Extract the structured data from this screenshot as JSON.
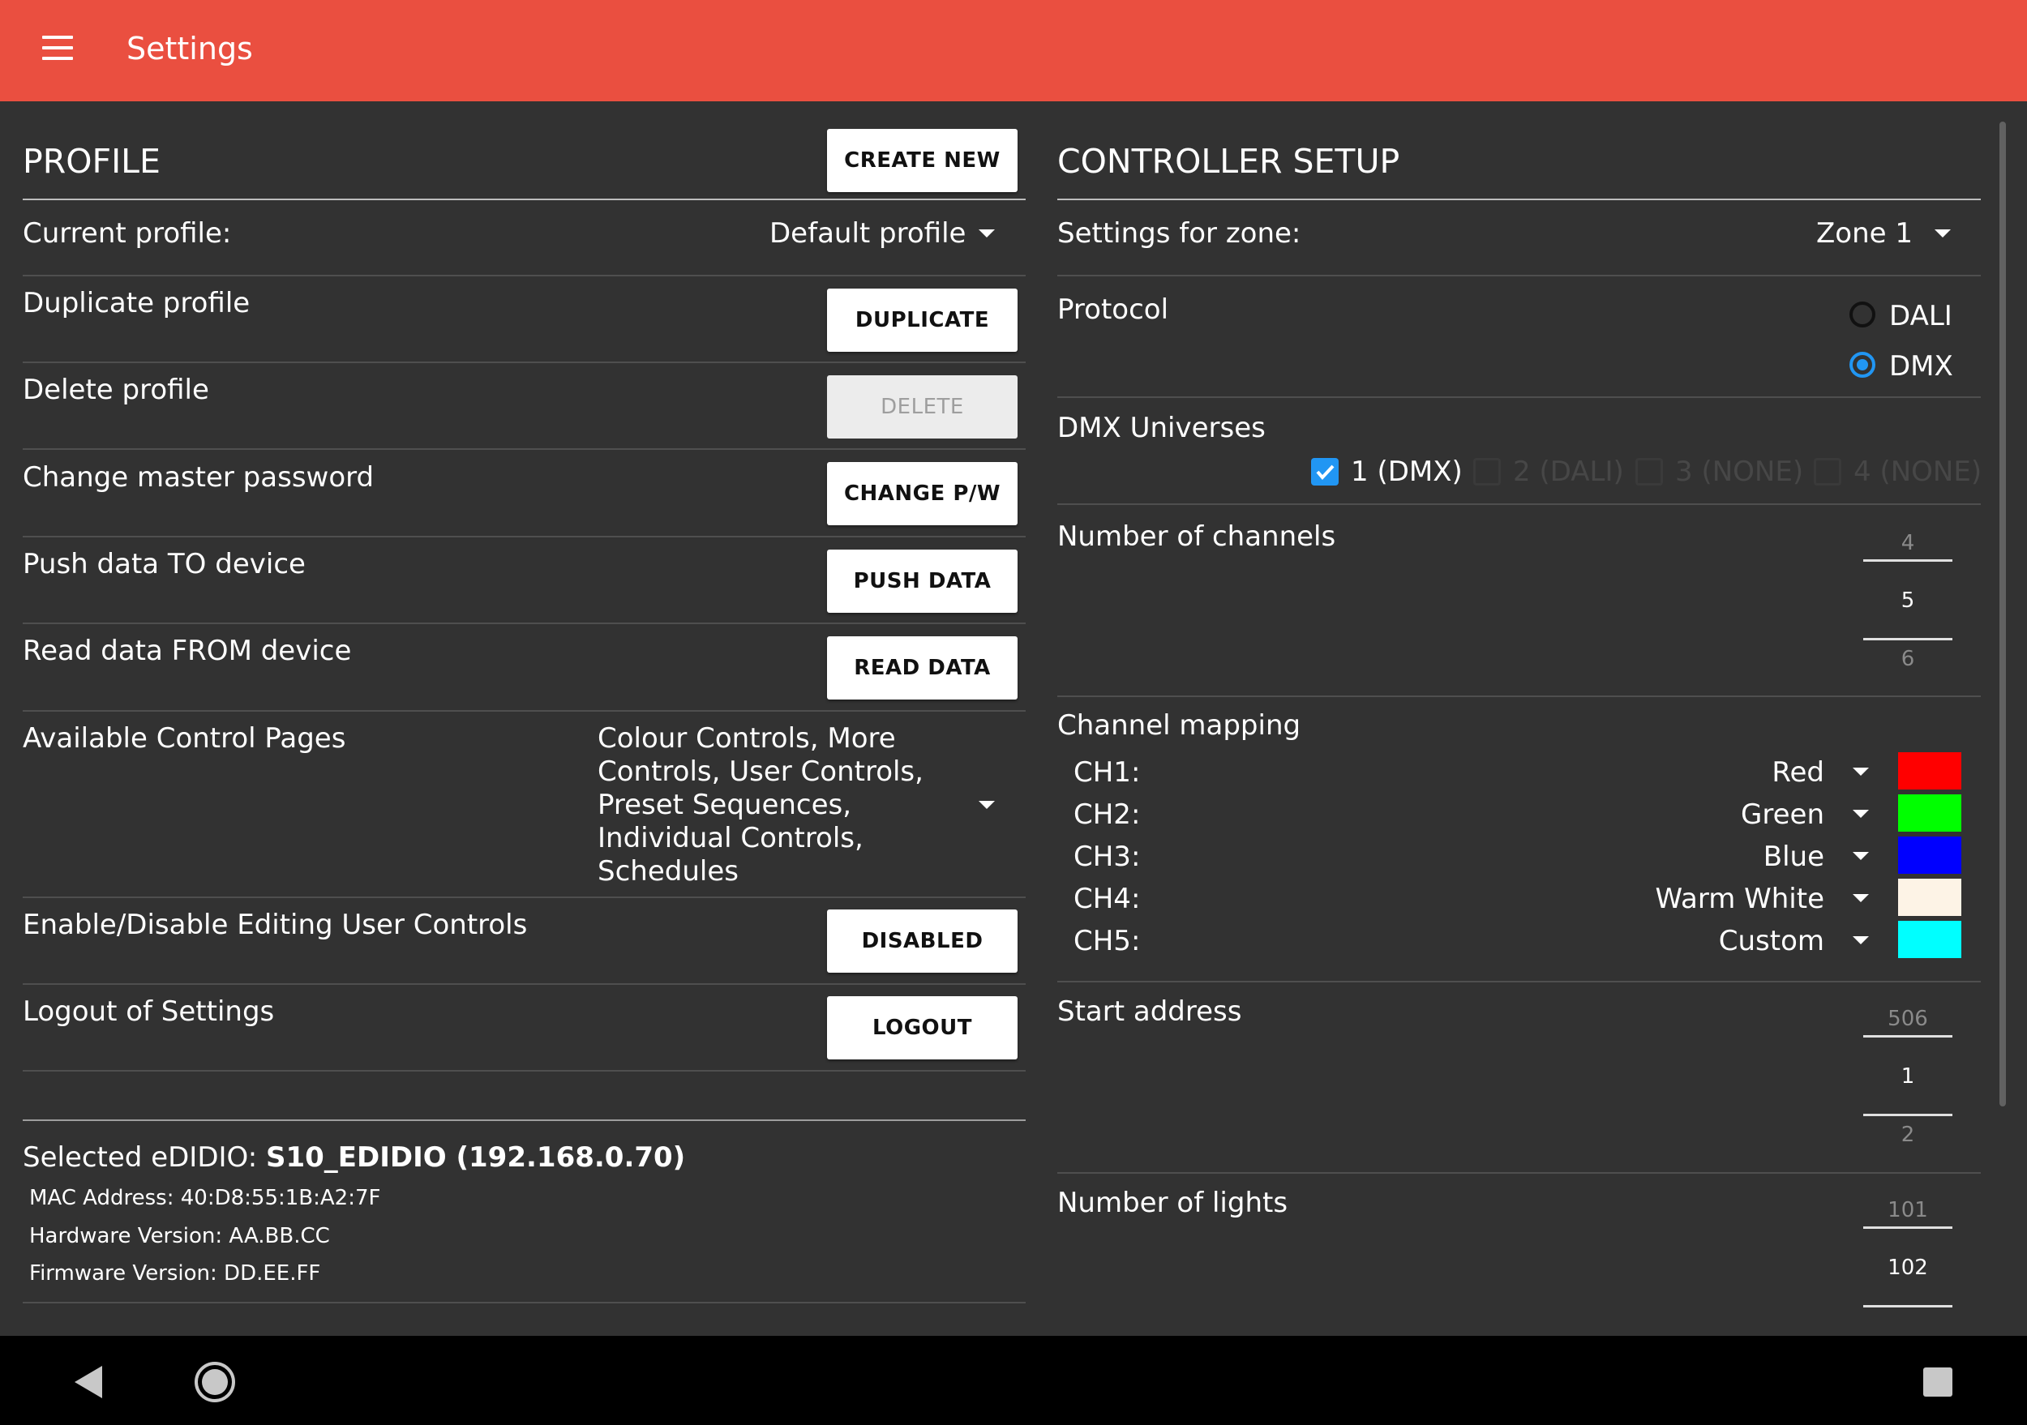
{
  "app_bar": {
    "title": "Settings",
    "menu_icon": "hamburger-menu-icon",
    "color": "#ea4f40"
  },
  "profile": {
    "title": "PROFILE",
    "create_new_label": "CREATE NEW",
    "current_profile_label": "Current profile:",
    "current_profile_value": "Default profile",
    "duplicate_label": "Duplicate profile",
    "duplicate_button": "DUPLICATE",
    "delete_label": "Delete profile",
    "delete_button": "DELETE",
    "change_pw_label": "Change master password",
    "change_pw_button": "CHANGE P/W",
    "push_label": "Push data TO device",
    "push_button": "PUSH DATA",
    "read_label": "Read data FROM device",
    "read_button": "READ DATA",
    "control_pages_label": "Available Control Pages",
    "control_pages_lines": [
      "Colour Controls, More",
      "Controls, User Controls,",
      "Preset Sequences,",
      "Individual Controls,",
      "Schedules"
    ],
    "edit_user_controls_label": "Enable/Disable Editing User Controls",
    "edit_user_controls_button": "DISABLED",
    "logout_label": "Logout of Settings",
    "logout_button": "LOGOUT"
  },
  "device": {
    "selected_prefix": "Selected eDIDIO: ",
    "selected_name": "S10_EDIDIO (192.168.0.70)",
    "mac": "MAC Address: 40:D8:55:1B:A2:7F",
    "hardware": "Hardware Version: AA.BB.CC",
    "firmware": "Firmware Version: DD.EE.FF"
  },
  "controller": {
    "title": "CONTROLLER SETUP",
    "zone_label": "Settings for zone:",
    "zone_value": "Zone 1",
    "protocol_label": "Protocol",
    "protocol_options": [
      "DALI",
      "DMX"
    ],
    "protocol_selected": "DMX",
    "universes_label": "DMX Universes",
    "universes": [
      {
        "label": "1 (DMX)",
        "checked": true,
        "enabled": true
      },
      {
        "label": "2 (DALI)",
        "checked": false,
        "enabled": false
      },
      {
        "label": "3 (NONE)",
        "checked": false,
        "enabled": false
      },
      {
        "label": "4 (NONE)",
        "checked": false,
        "enabled": false
      }
    ],
    "channels_label": "Number of channels",
    "channels_picker": {
      "prev": "4",
      "current": "5",
      "next": "6"
    },
    "mapping_label": "Channel mapping",
    "mapping": [
      {
        "ch": "CH1:",
        "value": "Red",
        "color": "#ff0000"
      },
      {
        "ch": "CH2:",
        "value": "Green",
        "color": "#00ff00"
      },
      {
        "ch": "CH3:",
        "value": "Blue",
        "color": "#0000ff"
      },
      {
        "ch": "CH4:",
        "value": "Warm White",
        "color": "#fdf3e6"
      },
      {
        "ch": "CH5:",
        "value": "Custom",
        "color": "#00ffff"
      }
    ],
    "start_address_label": "Start address",
    "start_address_picker": {
      "prev": "506",
      "current": "1",
      "next": "2"
    },
    "lights_label": "Number of lights",
    "lights_picker": {
      "prev": "101",
      "current": "102"
    }
  },
  "nav_bar": {
    "back_icon": "back-icon",
    "home_icon": "home-icon",
    "recents_icon": "recents-icon"
  }
}
